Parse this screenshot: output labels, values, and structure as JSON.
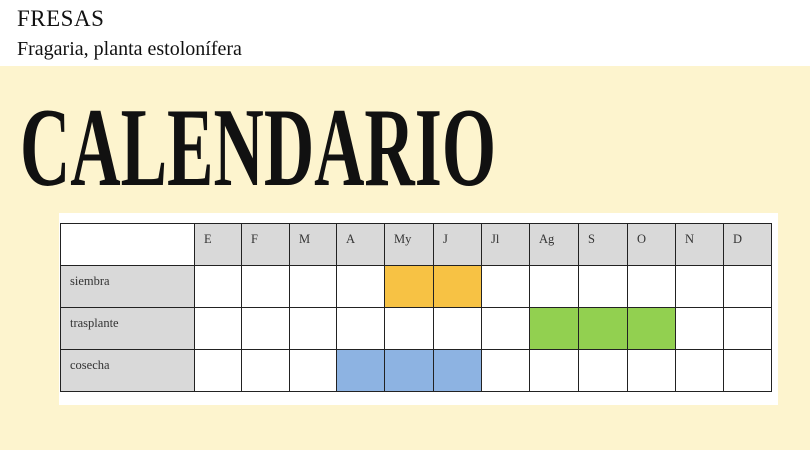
{
  "header": {
    "title": "FRESAS",
    "subtitle": "Fragaria, planta estolonífera"
  },
  "banner": {
    "text": "CALENDARIO"
  },
  "calendar": {
    "months": [
      "E",
      "F",
      "M",
      "A",
      "My",
      "J",
      "Jl",
      "Ag",
      "S",
      "O",
      "N",
      "D"
    ],
    "rows": [
      {
        "label": "siembra",
        "color": "#f7c244",
        "active": [
          "My",
          "J"
        ]
      },
      {
        "label": "trasplante",
        "color": "#92d050",
        "active": [
          "Ag",
          "S",
          "O"
        ]
      },
      {
        "label": "cosecha",
        "color": "#8db3e2",
        "active": [
          "A",
          "My",
          "J"
        ]
      }
    ]
  },
  "colors": {
    "panel": "#fdf4ce",
    "header_cell": "#d9d9d9"
  }
}
